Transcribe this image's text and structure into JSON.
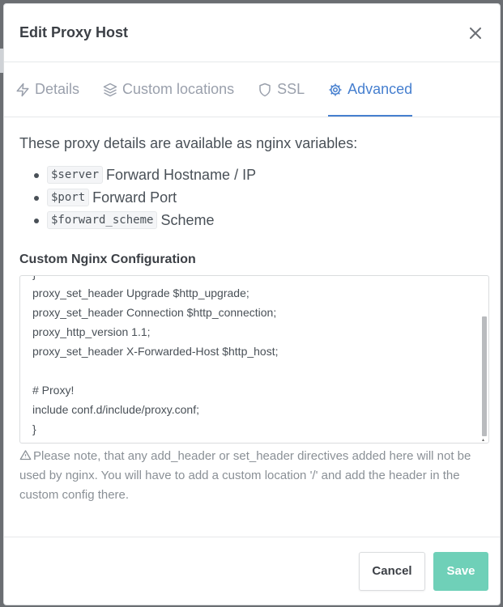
{
  "modal": {
    "title": "Edit Proxy Host"
  },
  "tabs": [
    {
      "label": "Details",
      "icon": "lightning-icon"
    },
    {
      "label": "Custom locations",
      "icon": "layers-icon"
    },
    {
      "label": "SSL",
      "icon": "shield-icon"
    },
    {
      "label": "Advanced",
      "icon": "gear-icon",
      "active": true
    }
  ],
  "intro": "These proxy details are available as nginx variables:",
  "variables": [
    {
      "code": "$server",
      "desc": "Forward Hostname / IP"
    },
    {
      "code": "$port",
      "desc": "Forward Port"
    },
    {
      "code": "$forward_scheme",
      "desc": "Scheme"
    }
  ],
  "config": {
    "label": "Custom Nginx Configuration",
    "lines": [
      "}",
      "proxy_set_header Upgrade $http_upgrade;",
      "proxy_set_header Connection $http_connection;",
      "proxy_http_version 1.1;",
      "proxy_set_header X-Forwarded-Host $http_host;",
      "",
      "# Proxy!",
      "include conf.d/include/proxy.conf;",
      "}"
    ],
    "note": "Please note, that any add_header or set_header directives added here will not be used by nginx. You will have to add a custom location '/' and add the header in the custom config there."
  },
  "footer": {
    "cancel_label": "Cancel",
    "save_label": "Save"
  },
  "colors": {
    "accent": "#467fcf",
    "save_button": "#6fd0b8"
  }
}
